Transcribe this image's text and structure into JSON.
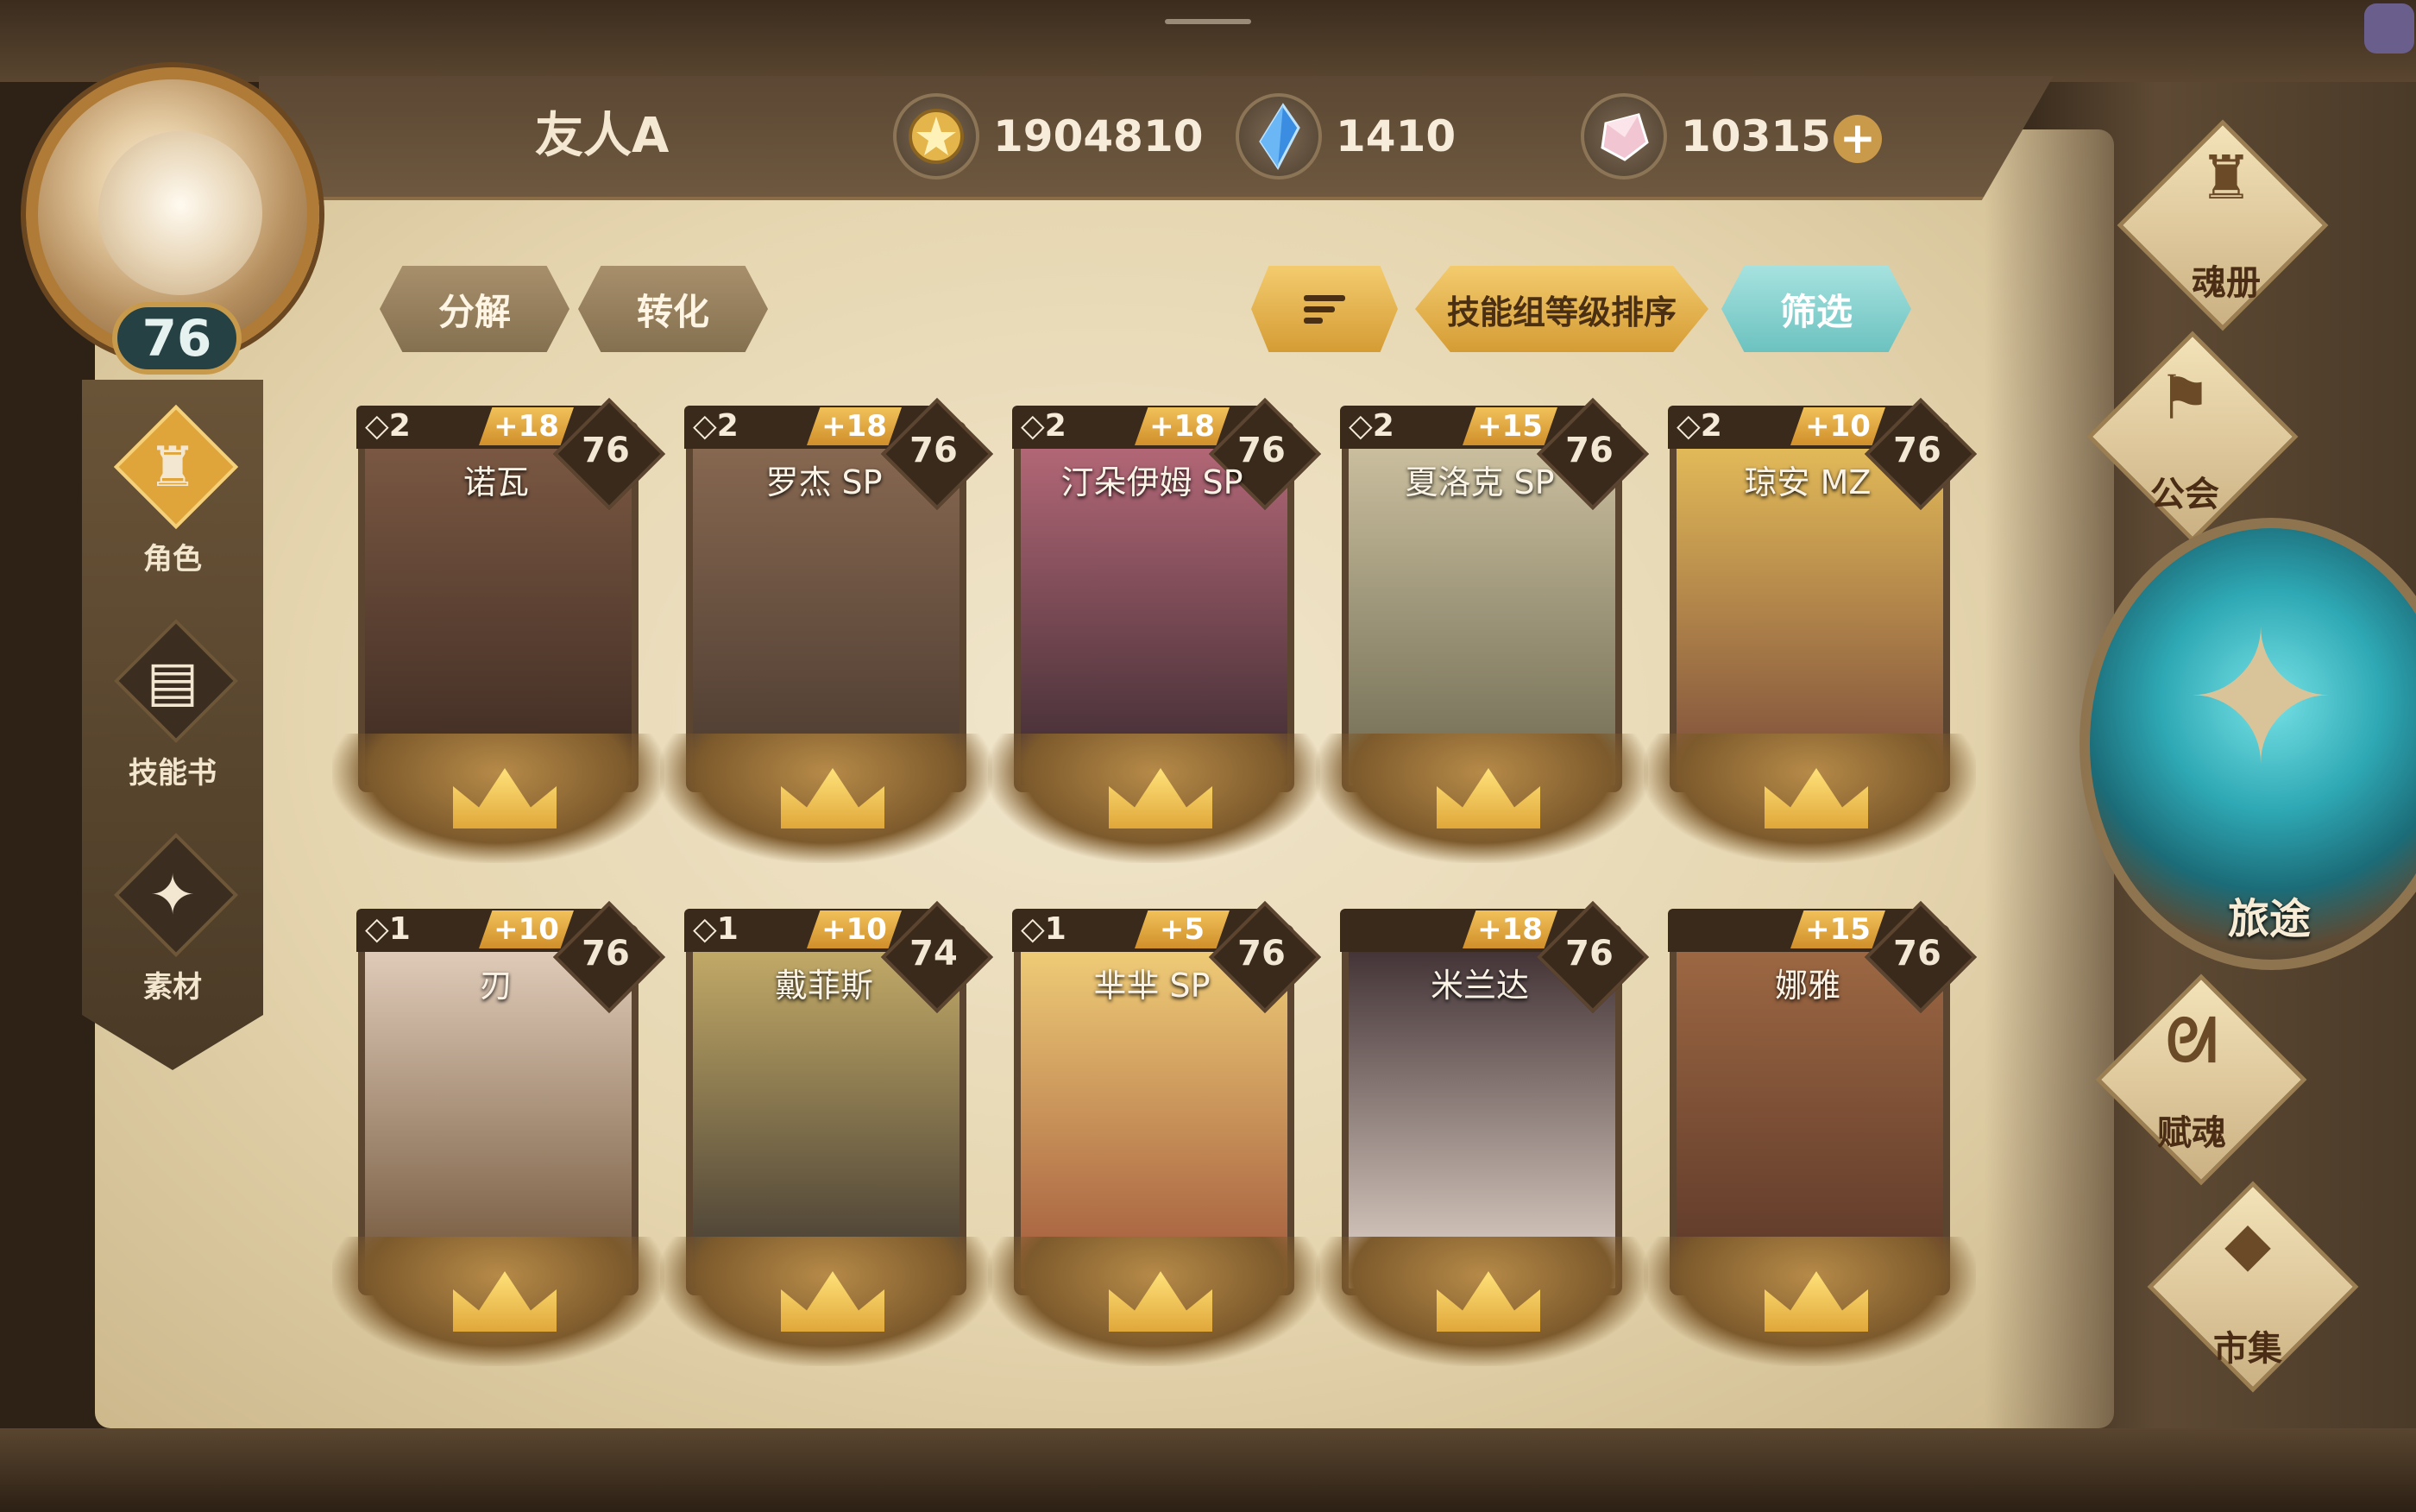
{
  "player": {
    "name": "友人A",
    "level": "76"
  },
  "currencies": [
    {
      "icon": "gold-coin-icon",
      "value": "1904810"
    },
    {
      "icon": "blue-crystal-icon",
      "value": "1410"
    },
    {
      "icon": "pink-gem-icon",
      "value": "10315"
    }
  ],
  "left_nav": [
    {
      "label": "角色",
      "icon": "helmet-icon",
      "active": true
    },
    {
      "label": "技能书",
      "icon": "skill-book-icon",
      "active": false
    },
    {
      "label": "素材",
      "icon": "material-icon",
      "active": false
    }
  ],
  "actions": {
    "decompose": "分解",
    "convert": "转化",
    "sort_order_icon": "sort-icon",
    "sort_label": "技能组等级排序",
    "filter": "筛选"
  },
  "cards": [
    {
      "name": "诺瓦",
      "rank": "2",
      "plus": "+18",
      "level": "76"
    },
    {
      "name": "罗杰 SP",
      "rank": "2",
      "plus": "+18",
      "level": "76"
    },
    {
      "name": "汀朵伊姆 SP",
      "rank": "2",
      "plus": "+18",
      "level": "76"
    },
    {
      "name": "夏洛克 SP",
      "rank": "2",
      "plus": "+15",
      "level": "76"
    },
    {
      "name": "琼安 MZ",
      "rank": "2",
      "plus": "+10",
      "level": "76"
    },
    {
      "name": "刃",
      "rank": "1",
      "plus": "+10",
      "level": "76"
    },
    {
      "name": "戴菲斯",
      "rank": "1",
      "plus": "+10",
      "level": "74"
    },
    {
      "name": "芈芈 SP",
      "rank": "1",
      "plus": "+5",
      "level": "76"
    },
    {
      "name": "米兰达",
      "rank": "",
      "plus": "+18",
      "level": "76"
    },
    {
      "name": "娜雅",
      "rank": "",
      "plus": "+15",
      "level": "76"
    }
  ],
  "right_menu": {
    "soul_book": "魂册",
    "guild": "公会",
    "journey": "旅途",
    "soul_grant": "赋魂",
    "market": "市集"
  },
  "colors": {
    "accent_gold": "#d59c34",
    "accent_cyan": "#6cc2c0",
    "parchment": "#e6d6b0"
  }
}
